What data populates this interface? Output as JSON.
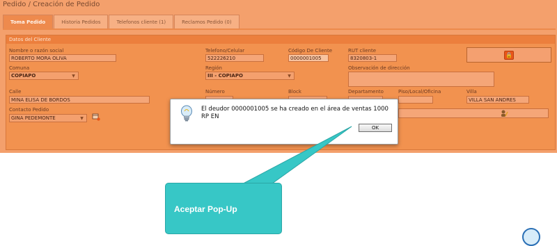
{
  "page": {
    "title": "Pedido / Creación de Pedido"
  },
  "tabs": [
    {
      "label": "Toma Pedido"
    },
    {
      "label": "Historia Pedidos"
    },
    {
      "label": "Telefonos cliente (1)"
    },
    {
      "label": "Reclamos Pedido (0)"
    }
  ],
  "panel": {
    "title": "Datos del Cliente",
    "nombre_label": "Nombre o razón social",
    "nombre_value": "ROBERTO MORA OLIVA",
    "telefono_label": "Telefono/Celular",
    "telefono_value": "522226210",
    "codigo_label": "Código De Cliente",
    "codigo_value": "0000001005",
    "rut_label": "RUT cliente",
    "rut_value": "8320803-1",
    "comuna_label": "Comuna",
    "comuna_value": "COPIAPO",
    "region_label": "Región",
    "region_value": "III - COPIAPO",
    "observacion_label": "Observación de dirección",
    "observacion_value": "",
    "calle_label": "Calle",
    "calle_value": "MINA ELISA DE BORDOS",
    "numero_label": "Número",
    "numero_value": "",
    "block_label": "Block",
    "block_value": "",
    "depto_label": "Departamento",
    "depto_value": "",
    "piso_label": "Piso/Local/Oficina",
    "piso_value": "",
    "villa_label": "Villa",
    "villa_value": "VILLA SAN ANDRES",
    "contacto_label": "Contacto Pedido",
    "contacto_value": "GINA PEDEMONTE"
  },
  "dialog": {
    "message": "El deudor 0000001005 se ha creado en el área de ventas 1000 RP EN",
    "ok_label": "OK"
  },
  "callout": {
    "text": "Aceptar Pop-Up"
  },
  "colors": {
    "app_bg": "#f4a06c",
    "panel_bg": "#f2924f",
    "accent": "#e8561a",
    "callout": "#37c7c6"
  }
}
